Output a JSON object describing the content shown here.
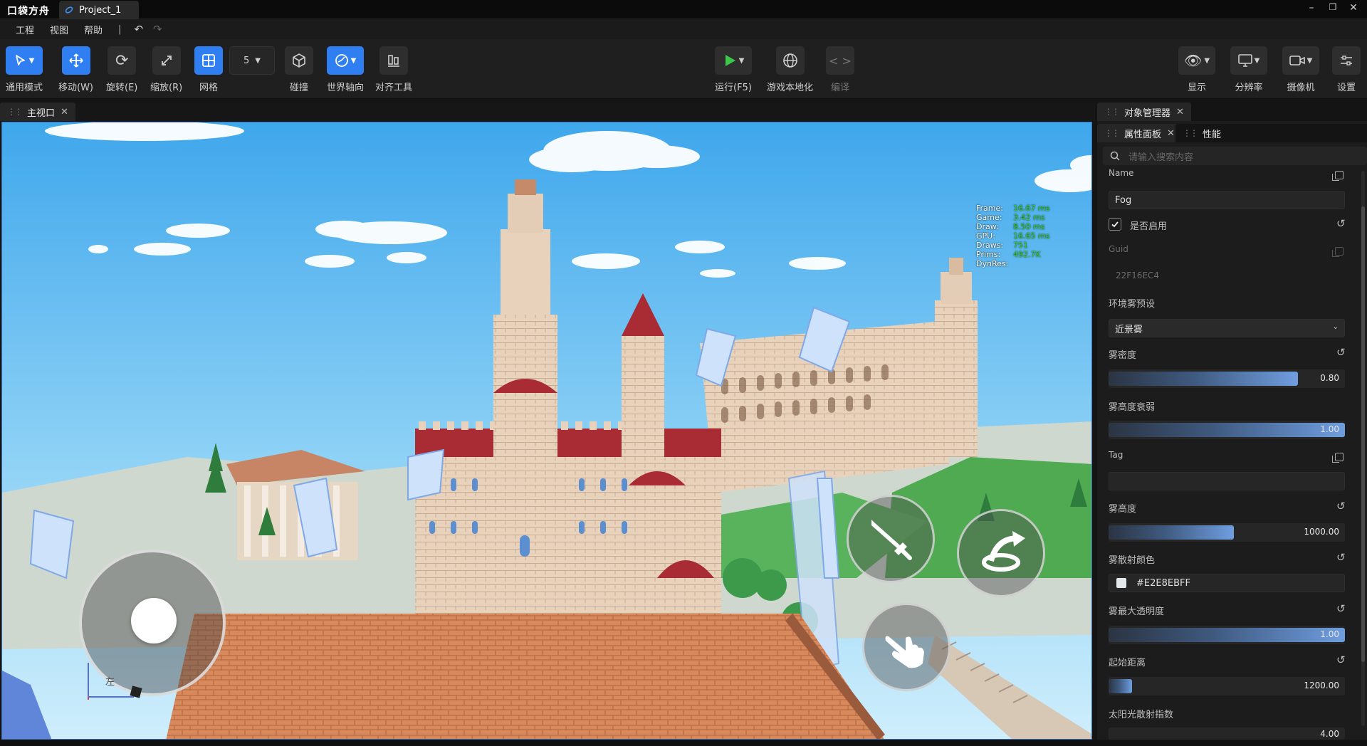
{
  "titlebar": {
    "logo": "口袋方舟",
    "project_tab": "Project_1"
  },
  "menu": [
    "工程",
    "视图",
    "帮助"
  ],
  "menu_separator": "|",
  "toolbar": {
    "mode_select": "通用模式",
    "move": "移动(W)",
    "rotate": "旋转(E)",
    "scale": "缩放(R)",
    "grid": "网格",
    "grid_size": "5",
    "collision": "碰撞",
    "world_axis": "世界轴向",
    "align_tool": "对齐工具",
    "run": "运行(F5)",
    "localize": "游戏本地化",
    "compile": "编译",
    "display": "显示",
    "resolution": "分辨率",
    "camera": "摄像机",
    "settings": "设置"
  },
  "viewport": {
    "tab": "主视口",
    "stats": [
      {
        "label": "Frame:",
        "value": "16.67 ms"
      },
      {
        "label": "Game:",
        "value": "3.42 ms"
      },
      {
        "label": "Draw:",
        "value": "8.50 ms"
      },
      {
        "label": "GPU:",
        "value": "16.65 ms"
      },
      {
        "label": "Draws:",
        "value": "751"
      },
      {
        "label": "Prims:",
        "value": "492.7K"
      },
      {
        "label": "DynRes:",
        "value": ""
      }
    ],
    "axis_label": "左"
  },
  "panels": {
    "object_manager_tab": "对象管理器",
    "property_tab": "属性面板",
    "performance_tab": "性能",
    "search_placeholder": "请输入搜索内容"
  },
  "properties": {
    "name_label": "Name",
    "name_value": "Fog",
    "enabled_label": "是否启用",
    "enabled": true,
    "guid_label": "Guid",
    "guid_value": "22F16EC4",
    "preset_label": "环境雾预设",
    "preset_value": "近景雾",
    "density_label": "雾密度",
    "density_value": "0.80",
    "density_level": 0.8,
    "height_falloff_label": "雾高度衰弱",
    "height_falloff_value": "1.00",
    "height_falloff_level": 1.0,
    "tag_label": "Tag",
    "tag_value": "",
    "height_label": "雾高度",
    "height_value": "1000.00",
    "height_level": 0.53,
    "color_label": "雾散射颜色",
    "color_value": "#E2E8EBFF",
    "color_swatch": "#E2E8EB",
    "max_opacity_label": "雾最大透明度",
    "max_opacity_value": "1.00",
    "max_opacity_level": 1.0,
    "start_distance_label": "起始距离",
    "start_distance_value": "1200.00",
    "start_distance_level": 0.1,
    "sun_scatter_label": "太阳光散射指数",
    "sun_scatter_value": "4.00"
  },
  "colors": {
    "accent": "#2F7FF2",
    "run_green": "#3CC94A",
    "stat_value": "#35D11E"
  }
}
